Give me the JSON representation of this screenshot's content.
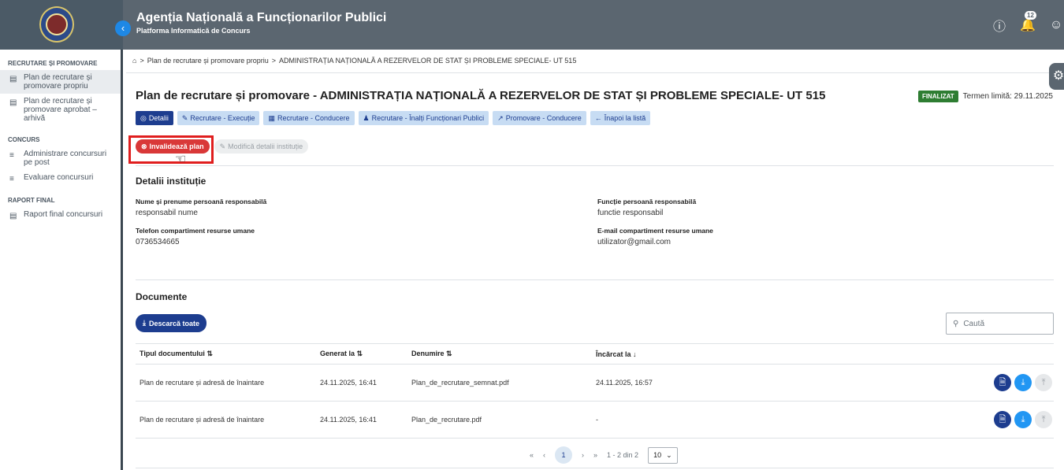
{
  "header": {
    "title": "Agenția Națională a Funcționarilor Publici",
    "subtitle": "Platforma Informatică de Concurs",
    "notifications_count": "12"
  },
  "sidebar": {
    "sections": [
      {
        "title": "RECRUTARE ȘI PROMOVARE",
        "items": [
          {
            "label": "Plan de recrutare și promovare propriu"
          },
          {
            "label": "Plan de recrutare și promovare aprobat – arhivă"
          }
        ]
      },
      {
        "title": "CONCURS",
        "items": [
          {
            "label": "Administrare concursuri pe post"
          },
          {
            "label": "Evaluare concursuri"
          }
        ]
      },
      {
        "title": "RAPORT FINAL",
        "items": [
          {
            "label": "Raport final concursuri"
          }
        ]
      }
    ]
  },
  "breadcrumb": {
    "item1": "Plan de recrutare și promovare propriu",
    "item2": "ADMINISTRAȚIA NAȚIONALĂ A REZERVELOR DE STAT ȘI PROBLEME SPECIALE- UT 515"
  },
  "page": {
    "title": "Plan de recrutare și promovare - ADMINISTRAȚIA NAȚIONALĂ A REZERVELOR DE STAT ȘI PROBLEME SPECIALE- UT 515",
    "status": "FINALIZAT",
    "deadline": "Termen limită: 29.11.2025"
  },
  "tabs": [
    {
      "label": "Detalii"
    },
    {
      "label": "Recrutare - Execuție"
    },
    {
      "label": "Recrutare - Conducere"
    },
    {
      "label": "Recrutare - Înalți Funcționari Publici"
    },
    {
      "label": "Promovare - Conducere"
    },
    {
      "label": "Înapoi la listă"
    }
  ],
  "actions": {
    "invalidate": "Invalidează plan",
    "edit": "Modifică detalii instituție"
  },
  "details": {
    "title": "Detalii instituție",
    "name_label": "Nume și prenume persoană responsabilă",
    "name_value": "responsabil nume",
    "function_label": "Funcție persoană responsabilă",
    "function_value": "functie responsabil",
    "phone_label": "Telefon compartiment resurse umane",
    "phone_value": "0736534665",
    "email_label": "E-mail compartiment resurse umane",
    "email_value": "utilizator@gmail.com"
  },
  "documents": {
    "title": "Documente",
    "download_all": "Descarcă toate",
    "search_placeholder": "Caută",
    "columns": [
      "Tipul documentului",
      "Generat la",
      "Denumire",
      "Încărcat la"
    ],
    "rows": [
      [
        "Plan de recrutare și adresă de înaintare",
        "24.11.2025, 16:41",
        "Plan_de_recrutare_semnat.pdf",
        "24.11.2025, 16:57"
      ],
      [
        "Plan de recrutare și adresă de înaintare",
        "24.11.2025, 16:41",
        "Plan_de_recrutare.pdf",
        "-"
      ]
    ]
  },
  "pagination": {
    "current_page": "1",
    "summary": "1 - 2 din 2",
    "page_size": "10"
  }
}
